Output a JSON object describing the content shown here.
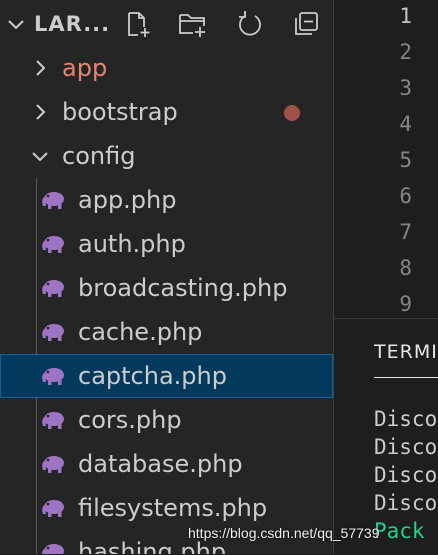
{
  "explorer": {
    "title": "LAR...",
    "actions": [
      "new-file-icon",
      "new-folder-icon",
      "refresh-icon",
      "collapse-all-icon"
    ]
  },
  "tree": {
    "folders": [
      {
        "label": "app",
        "expanded": false,
        "modified": true,
        "color": "#e8836f"
      },
      {
        "label": "bootstrap",
        "expanded": false
      },
      {
        "label": "config",
        "expanded": true
      }
    ],
    "files": [
      {
        "label": "app.php"
      },
      {
        "label": "auth.php"
      },
      {
        "label": "broadcasting.php"
      },
      {
        "label": "cache.php"
      },
      {
        "label": "captcha.php",
        "selected": true
      },
      {
        "label": "cors.php"
      },
      {
        "label": "database.php"
      },
      {
        "label": "filesystems.php"
      },
      {
        "label": "hashing.php"
      }
    ],
    "file_icon": "php-elephant-icon",
    "file_icon_color": "#a074c4"
  },
  "editor": {
    "line_numbers": [
      "1",
      "2",
      "3",
      "4",
      "5",
      "6",
      "7",
      "8",
      "9"
    ]
  },
  "panel": {
    "tab": "TERMI",
    "lines": [
      "Disco",
      "Disco",
      "Disco",
      "Disco",
      "Pack"
    ]
  },
  "watermark": "https://blog.csdn.net/qq_57739"
}
